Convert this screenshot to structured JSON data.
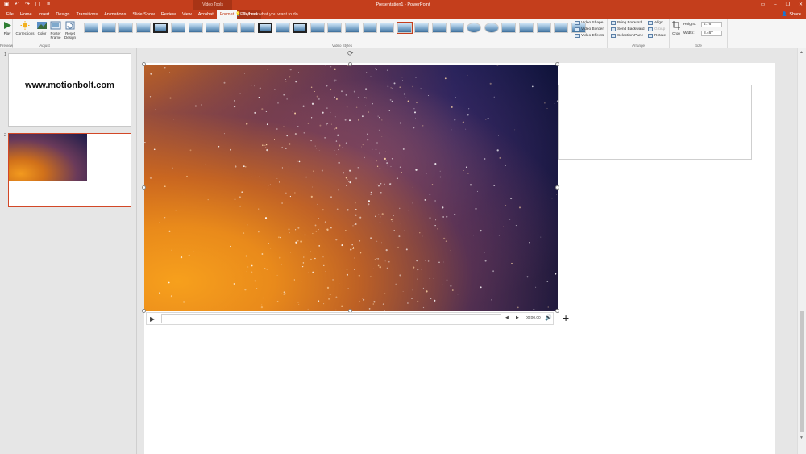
{
  "titlebar": {
    "app_title": "Presentation1 - PowerPoint",
    "context_tab_title": "Video Tools",
    "qat": [
      "▣",
      "↶",
      "↷",
      "▢",
      "≡"
    ]
  },
  "tabs": [
    "File",
    "Home",
    "Insert",
    "Design",
    "Transitions",
    "Animations",
    "Slide Show",
    "Review",
    "View",
    "Acrobat",
    "Format",
    "Playback"
  ],
  "active_tab": "Format",
  "tell_me": "Tell me what you want to do...",
  "share_label": "Share",
  "ribbon": {
    "preview": {
      "play_label": "Play",
      "group_label": "Preview"
    },
    "adjust": {
      "corrections_label": "Corrections",
      "color_label": "Color",
      "poster_frame_label": "Poster Frame",
      "reset_design_label": "Reset Design",
      "group_label": "Adjust"
    },
    "video_styles": {
      "group_label": "Video Styles",
      "video_shape": "Video Shape",
      "video_border": "Video Border",
      "video_effects": "Video Effects"
    },
    "arrange": {
      "group_label": "Arrange",
      "bring_forward": "Bring Forward",
      "send_backward": "Send Backward",
      "selection_pane": "Selection Pane",
      "align": "Align",
      "group": "Group",
      "rotate": "Rotate"
    },
    "size": {
      "group_label": "Size",
      "crop_label": "Crop",
      "height_label": "Height:",
      "height_value": "4.76\"",
      "width_label": "Width:",
      "width_value": "8.46\""
    }
  },
  "slides": [
    {
      "number": "1",
      "text": "www.motionbolt.com"
    },
    {
      "number": "2"
    }
  ],
  "playback": {
    "timecode": "00:00.00"
  },
  "colors": {
    "accent": "#c43e1c",
    "ribbon_bg": "#f5f5f5",
    "canvas_bg": "#e6e6e6"
  }
}
